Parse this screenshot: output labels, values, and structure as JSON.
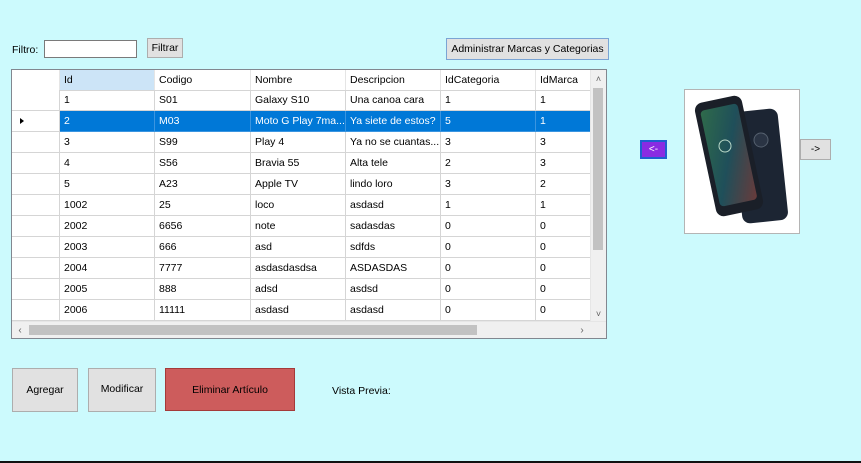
{
  "filter": {
    "label": "Filtro:",
    "value": "",
    "placeholder": "",
    "button_label": "Filtrar"
  },
  "admin_button_label": "Administrar Marcas y Categorias",
  "grid": {
    "columns": [
      "Id",
      "Codigo",
      "Nombre",
      "Descripcion",
      "IdCategoria",
      "IdMarca"
    ],
    "selected_row_index": 1,
    "rows": [
      [
        "1",
        "S01",
        "Galaxy S10",
        "Una canoa cara",
        "1",
        "1"
      ],
      [
        "2",
        "M03",
        "Moto G Play 7ma...",
        "Ya siete de estos?",
        "5",
        "1"
      ],
      [
        "3",
        "S99",
        "Play 4",
        "Ya no se cuantas...",
        "3",
        "3"
      ],
      [
        "4",
        "S56",
        "Bravia 55",
        "Alta tele",
        "2",
        "3"
      ],
      [
        "5",
        "A23",
        "Apple TV",
        "lindo loro",
        "3",
        "2"
      ],
      [
        "1002",
        "25",
        "loco",
        "asdasd",
        "1",
        "1"
      ],
      [
        "2002",
        "6656",
        "note",
        "sadasdas",
        "0",
        "0"
      ],
      [
        "2003",
        "666",
        "asd",
        "sdfds",
        "0",
        "0"
      ],
      [
        "2004",
        "7777",
        "asdasdasdsa",
        "ASDASDAS",
        "0",
        "0"
      ],
      [
        "2005",
        "888",
        "adsd",
        "asdsd",
        "0",
        "0"
      ],
      [
        "2006",
        "11111",
        "asdasd",
        "asdasd",
        "0",
        "0"
      ]
    ]
  },
  "image_nav": {
    "prev_label": "<-",
    "next_label": "->"
  },
  "buttons": {
    "agregar": "Agregar",
    "modificar": "Modificar",
    "eliminar": "Eliminar Artículo"
  },
  "vista_previa_label": "Vista Previa:",
  "colors": {
    "background": "#ccfafd",
    "selection": "#0078d7",
    "delete_button": "#cd5c5c",
    "prev_button": "#8a2be2"
  }
}
